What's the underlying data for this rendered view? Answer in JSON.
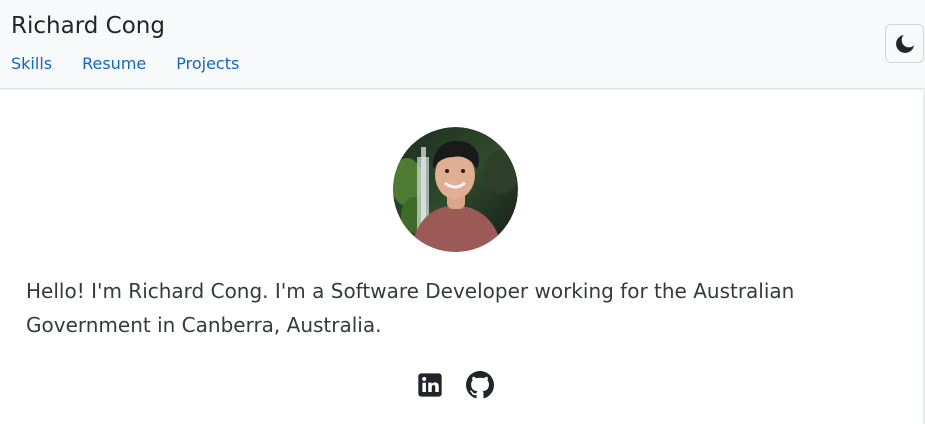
{
  "header": {
    "title": "Richard Cong",
    "nav": [
      {
        "label": "Skills"
      },
      {
        "label": "Resume"
      },
      {
        "label": "Projects"
      }
    ],
    "theme_toggle_icon": "moon-icon"
  },
  "main": {
    "avatar_alt": "Richard Cong",
    "bio": "Hello! I'm Richard Cong. I'm a Software Developer working for the Australian Government in Canberra, Australia.",
    "socials": [
      {
        "icon": "linkedin-icon"
      },
      {
        "icon": "github-icon"
      }
    ]
  },
  "colors": {
    "header_bg": "#f8f9fb",
    "link": "#1166c4",
    "text": "#343a40"
  }
}
